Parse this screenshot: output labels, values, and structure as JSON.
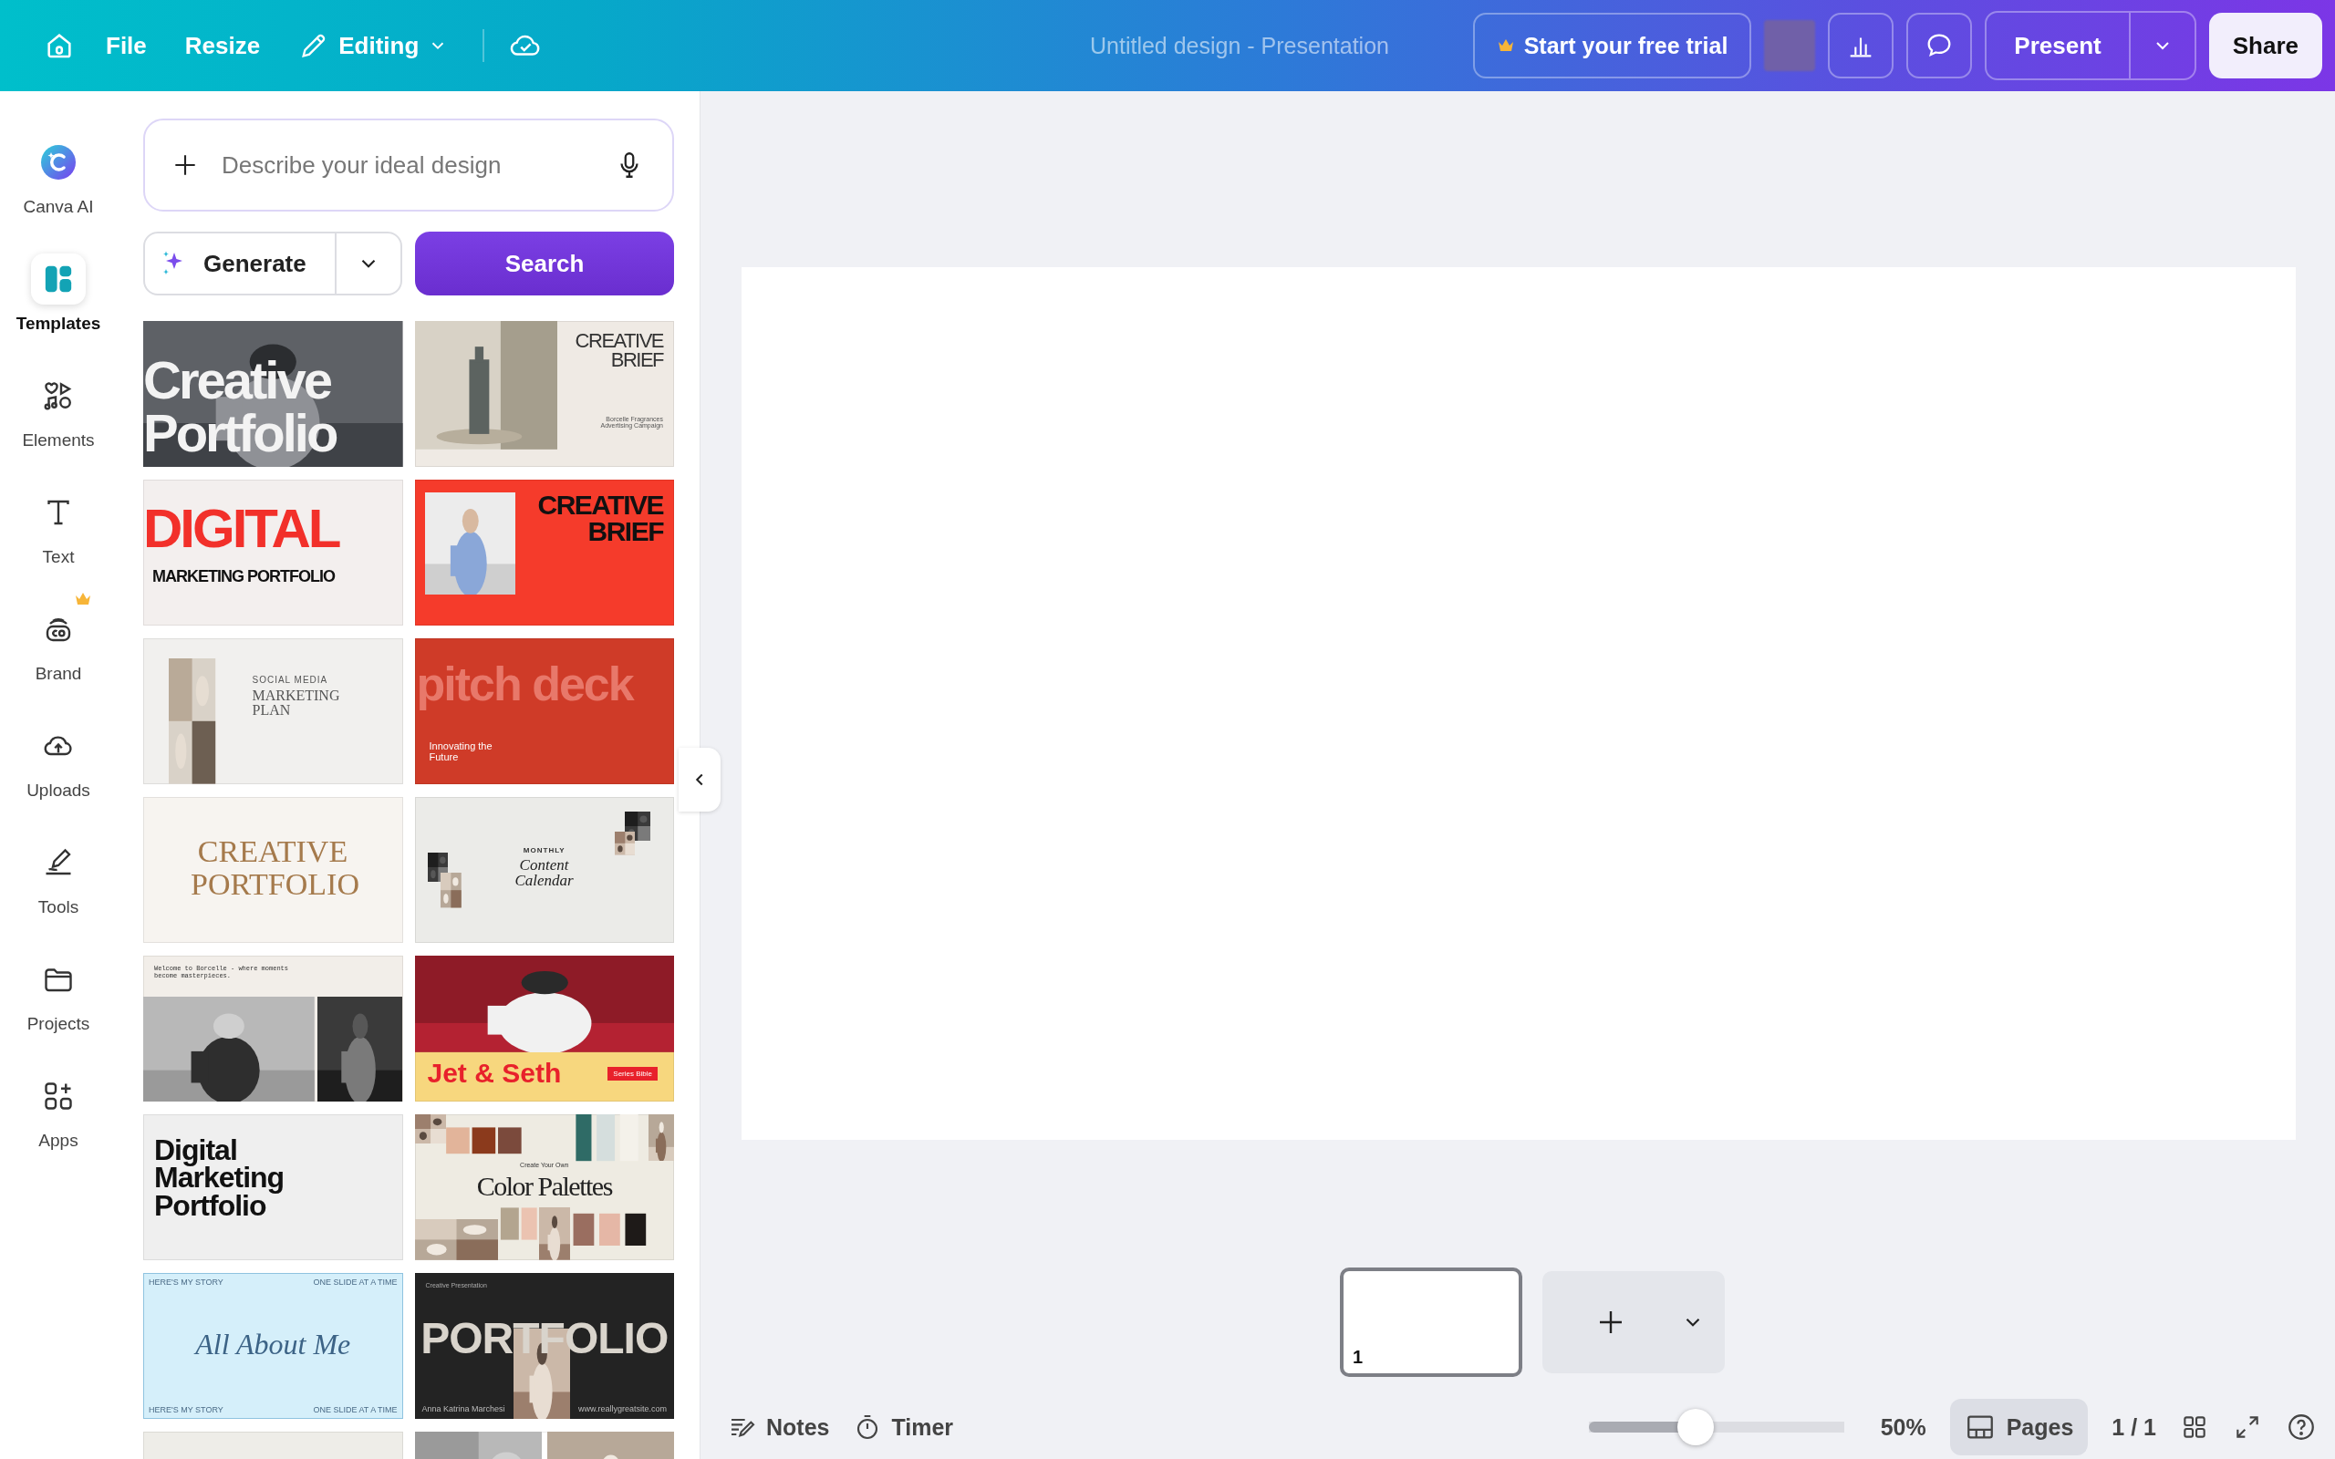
{
  "topbar": {
    "menu": [
      {
        "label": "File"
      },
      {
        "label": "Resize"
      }
    ],
    "mode": {
      "label": "Editing"
    },
    "title": "Untitled design - Presentation",
    "trial_button": "Start your free trial",
    "present_button": "Present",
    "share_button": "Share"
  },
  "sidebar": {
    "items": [
      {
        "kind": "ai",
        "label": "Canva AI",
        "selected": false,
        "premium": false
      },
      {
        "kind": "templates",
        "label": "Templates",
        "selected": true,
        "premium": false
      },
      {
        "kind": "elements",
        "label": "Elements",
        "selected": false,
        "premium": false
      },
      {
        "kind": "text",
        "label": "Text",
        "selected": false,
        "premium": false
      },
      {
        "kind": "brand",
        "label": "Brand",
        "selected": false,
        "premium": true
      },
      {
        "kind": "uploads",
        "label": "Uploads",
        "selected": false,
        "premium": false
      },
      {
        "kind": "tools",
        "label": "Tools",
        "selected": false,
        "premium": false
      },
      {
        "kind": "projects",
        "label": "Projects",
        "selected": false,
        "premium": false
      },
      {
        "kind": "apps",
        "label": "Apps",
        "selected": false,
        "premium": false
      }
    ]
  },
  "panel": {
    "prompt": {
      "placeholder": "Describe your ideal design"
    },
    "generate_button": "Generate",
    "search_button": "Search",
    "templates": [
      {
        "kind": "creative-portfolio-photo",
        "texts": [
          "Creative",
          "Portfolio"
        ]
      },
      {
        "kind": "creative-brief-light",
        "texts": [
          "CREATIVE BRIEF",
          "Borcelle Fragrances Advertising Campaign"
        ]
      },
      {
        "kind": "digital-marketing-red",
        "texts": [
          "DIGITAL",
          "MARKETING PORTFOLIO"
        ]
      },
      {
        "kind": "creative-brief-red",
        "texts": [
          "CREATIVE BRIEF"
        ]
      },
      {
        "kind": "social-media-plan",
        "texts": [
          "SOCIAL MEDIA",
          "MARKETING PLAN"
        ]
      },
      {
        "kind": "pitch-deck",
        "texts": [
          "pitch deck",
          "Innovating the Future"
        ]
      },
      {
        "kind": "creative-portfolio-serif",
        "texts": [
          "CREATIVE PORTFOLIO"
        ]
      },
      {
        "kind": "content-calendar",
        "texts": [
          "MONTHLY",
          "Content Calendar"
        ]
      },
      {
        "kind": "borcelle-photos",
        "texts": [
          "Welcome to Borcelle - where moments become masterpieces."
        ]
      },
      {
        "kind": "jet-seth",
        "texts": [
          "Jet & Seth",
          "Series Bible"
        ]
      },
      {
        "kind": "digital-marketing-black",
        "texts": [
          "Digital Marketing Portfolio"
        ]
      },
      {
        "kind": "color-palettes",
        "texts": [
          "Create Your Own",
          "Color Palettes"
        ]
      },
      {
        "kind": "about-me",
        "texts": [
          "HERE'S MY STORY",
          "ONE SLIDE AT A TIME",
          "All About Me",
          "HERE'S MY STORY",
          "ONE SLIDE AT A TIME"
        ]
      },
      {
        "kind": "portfolio-dark",
        "texts": [
          "Creative Presentation",
          "PORTFOLIO",
          "Anna Katrina Marchesi",
          "www.reallygreatsite.com"
        ]
      },
      {
        "kind": "cut-light"
      },
      {
        "kind": "cut-photo"
      }
    ]
  },
  "editor": {
    "pages": [
      {
        "number": "1",
        "selected": true
      }
    ]
  },
  "footer": {
    "notes": "Notes",
    "timer": "Timer",
    "zoom": {
      "level": 0.42,
      "reading": "50%"
    },
    "pages_button": {
      "label": "Pages",
      "selected": true
    },
    "page_count": "1 / 1"
  }
}
